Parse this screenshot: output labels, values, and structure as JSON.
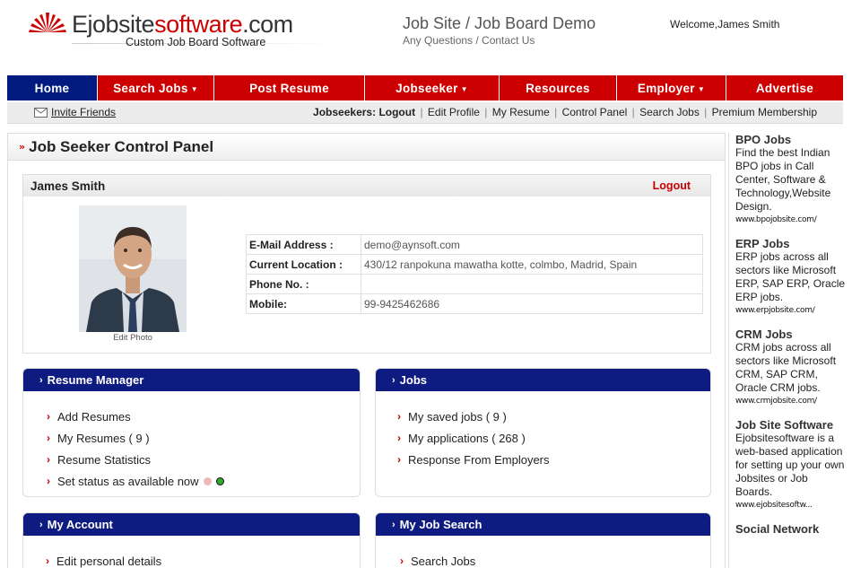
{
  "header": {
    "logo_main": "Ejobsite",
    "logo_accent": "software",
    "logo_suffix": ".com",
    "tagline": "Custom Job Board Software",
    "site_title": "Job Site / Job Board Demo",
    "site_sub": "Any Questions / Contact Us",
    "welcome": "Welcome,James Smith"
  },
  "nav": {
    "items": [
      {
        "label": "Home",
        "caret": ""
      },
      {
        "label": "Search Jobs",
        "caret": "▼"
      },
      {
        "label": "Post Resume",
        "caret": ""
      },
      {
        "label": "Jobseeker",
        "caret": "▼"
      },
      {
        "label": "Resources",
        "caret": ""
      },
      {
        "label": "Employer",
        "caret": "▼"
      },
      {
        "label": "Advertise",
        "caret": ""
      }
    ]
  },
  "subnav": {
    "invite": "Invite Friends",
    "label": "Jobseekers:",
    "links": [
      "Logout",
      "Edit Profile",
      "My Resume",
      "Control Panel",
      "Search Jobs",
      "Premium Membership"
    ]
  },
  "panel": {
    "title": "Job Seeker Control Panel",
    "profile": {
      "name": "James Smith",
      "logout": "Logout",
      "edit_photo": "Edit Photo",
      "fields": [
        {
          "label": "E-Mail Address :",
          "value": "demo@aynsoft.com"
        },
        {
          "label": "Current Location :",
          "value": "430/12 ranpokuna mawatha kotte, colmbo, Madrid, Spain"
        },
        {
          "label": "Phone No. :",
          "value": ""
        },
        {
          "label": "Mobile:",
          "value": "99-9425462686"
        }
      ]
    },
    "resume_manager": {
      "title": "Resume Manager",
      "items": [
        "Add Resumes",
        "My Resumes ( 9 )",
        "Resume Statistics",
        "Set status as available now"
      ]
    },
    "jobs": {
      "title": "Jobs",
      "items": [
        "My saved jobs ( 9 )",
        "My applications ( 268 )",
        "Response From Employers"
      ]
    },
    "my_account": {
      "title": "My Account",
      "items": [
        "Edit personal details"
      ]
    },
    "my_job_search": {
      "title": "My Job Search",
      "items": [
        "Search Jobs"
      ]
    }
  },
  "sidebar": {
    "ads": [
      {
        "title": "BPO Jobs",
        "text": "Find the best Indian BPO jobs in Call Center, Software & Technology,Website Design.",
        "url": "www.bpojobsite.com/"
      },
      {
        "title": "ERP Jobs",
        "text": "ERP jobs across all sectors like Microsoft ERP, SAP ERP, Oracle ERP jobs.",
        "url": "www.erpjobsite.com/"
      },
      {
        "title": "CRM Jobs",
        "text": "CRM jobs across all sectors like Microsoft CRM, SAP CRM, Oracle CRM jobs.",
        "url": "www.crmjobsite.com/"
      },
      {
        "title": "Job Site Software",
        "text": "Ejobsitesoftware is a web-based application for setting up your own Jobsites or Job Boards.",
        "url": "www.ejobsitesoftw..."
      },
      {
        "title": "Social Network",
        "text": "",
        "url": ""
      }
    ]
  },
  "colors": {
    "brand_red": "#cc0000",
    "navy": "#0e1b80",
    "status_green": "#2fa82f",
    "status_pink": "#f0b7bb"
  }
}
